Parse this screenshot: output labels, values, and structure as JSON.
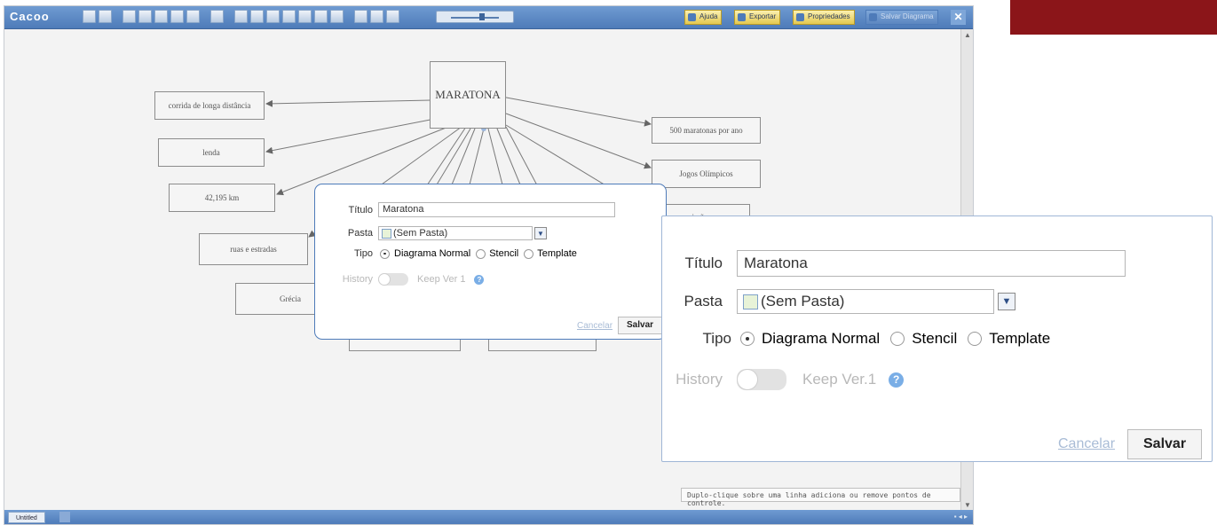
{
  "app": {
    "logo": "Cacoo",
    "ajuda_label": "Ajuda",
    "exportar_label": "Exportar",
    "propriedades_label": "Propriedades",
    "salvar_diagrama_label": "Salvar Diagrama",
    "close_label": "✕",
    "tab_label": "Untitled"
  },
  "diagram": {
    "center": "MARATONA",
    "nodes": [
      "corrida de longa distância",
      "lenda",
      "42,195 km",
      "ruas e estradas",
      "Grécia",
      "500 maratonas por ano",
      "Jogos Olímpicos",
      "missão"
    ]
  },
  "hint": "Duplo-clique sobre uma linha adiciona ou remove pontos de controle.",
  "dialog": {
    "titulo_label": "Título",
    "titulo_value": "Maratona",
    "pasta_label": "Pasta",
    "pasta_value": "(Sem Pasta)",
    "tipo_label": "Tipo",
    "tipo_options": [
      "Diagrama Normal",
      "Stencil",
      "Template"
    ],
    "tipo_selected": "Diagrama Normal",
    "history_label": "History",
    "keep_label": "Keep Ver.1",
    "help_icon": "?",
    "cancel_label": "Cancelar",
    "save_label": "Salvar"
  },
  "dialog_small": {
    "keep_label": "Keep Ver 1"
  },
  "colors": {
    "toolbar": "#5a87c3",
    "brand": "#8b1519",
    "dialog_border": "#4e7bb9"
  }
}
